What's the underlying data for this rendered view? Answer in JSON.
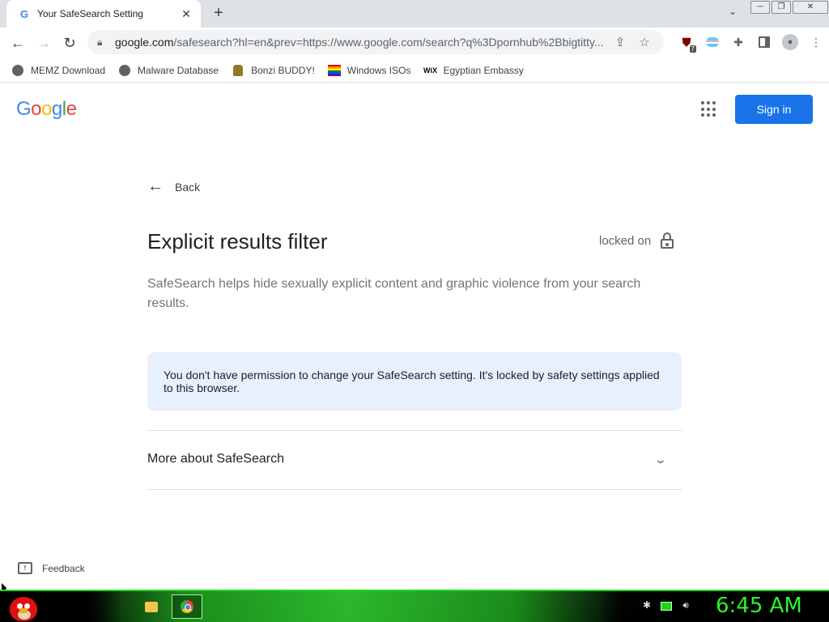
{
  "browser": {
    "tab_title": "Your SafeSearch Setting",
    "tab_favicon": "G",
    "tab_close": "✕",
    "new_tab": "+",
    "url_host": "google.com",
    "url_path": "/safesearch?hl=en&prev=https://www.google.com/search?q%3Dpornhub%2Bbigtitty...",
    "window_buttons": [
      "─",
      "❐",
      "✕"
    ],
    "extension_badge": "7"
  },
  "bookmarks": [
    {
      "label": "MEMZ Download",
      "icon": "globe-icon"
    },
    {
      "label": "Malware Database",
      "icon": "globe-icon"
    },
    {
      "label": "Bonzi BUDDY!",
      "icon": "bonzi-icon"
    },
    {
      "label": "Windows ISOs",
      "icon": "rainbow-flag-icon"
    },
    {
      "label": "Egyptian Embassy",
      "icon": "wix-icon"
    }
  ],
  "header": {
    "logo_letters": [
      "G",
      "o",
      "o",
      "g",
      "l",
      "e"
    ],
    "signin_label": "Sign in"
  },
  "main": {
    "back_label": "Back",
    "heading": "Explicit results filter",
    "locked_label": "locked on",
    "description": "SafeSearch helps hide sexually explicit content and graphic violence from your search results.",
    "notice": "You don't have permission to change your SafeSearch setting. It's locked by safety settings applied to this browser.",
    "more_label": "More about SafeSearch",
    "feedback_label": "Feedback"
  },
  "taskbar": {
    "clock": "6:45 AM",
    "accent": "#2cf52c"
  },
  "colors": {
    "primary_button": "#1a73e8",
    "notice_bg": "#e8f0fe"
  }
}
